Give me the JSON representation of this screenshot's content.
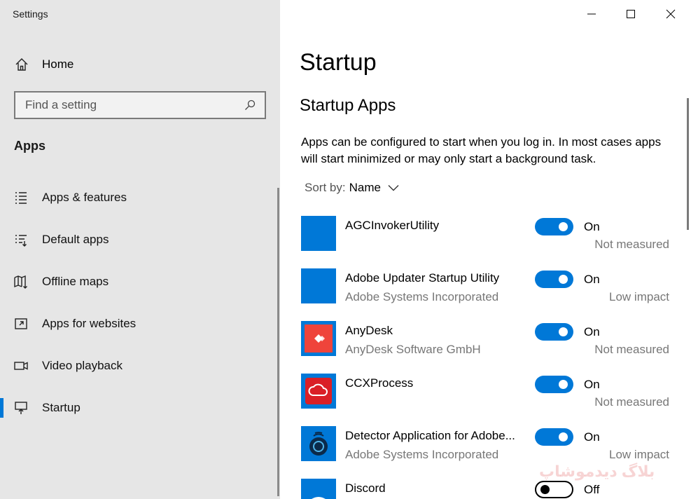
{
  "window": {
    "title": "Settings",
    "controls": [
      "minimize",
      "maximize",
      "close"
    ]
  },
  "sidebar": {
    "home_label": "Home",
    "search_placeholder": "Find a setting",
    "section_title": "Apps",
    "items": [
      {
        "label": "Apps & features",
        "icon": "apps-features-icon",
        "selected": false
      },
      {
        "label": "Default apps",
        "icon": "default-apps-icon",
        "selected": false
      },
      {
        "label": "Offline maps",
        "icon": "offline-maps-icon",
        "selected": false
      },
      {
        "label": "Apps for websites",
        "icon": "apps-websites-icon",
        "selected": false
      },
      {
        "label": "Video playback",
        "icon": "video-playback-icon",
        "selected": false
      },
      {
        "label": "Startup",
        "icon": "startup-icon",
        "selected": true
      }
    ]
  },
  "main": {
    "title": "Startup",
    "subtitle": "Startup Apps",
    "description": "Apps can be configured to start when you log in. In most cases apps will start minimized or may only start a background task.",
    "sort_label": "Sort by:",
    "sort_value": "Name",
    "apps": [
      {
        "name": "AGCInvokerUtility",
        "publisher": "",
        "state": "On",
        "impact": "Not measured",
        "icon": "blank-app-icon"
      },
      {
        "name": "Adobe Updater Startup Utility",
        "publisher": "Adobe Systems Incorporated",
        "state": "On",
        "impact": "Low impact",
        "icon": "blank-app-icon"
      },
      {
        "name": "AnyDesk",
        "publisher": "AnyDesk Software GmbH",
        "state": "On",
        "impact": "Not measured",
        "icon": "anydesk-icon"
      },
      {
        "name": "CCXProcess",
        "publisher": "",
        "state": "On",
        "impact": "Not measured",
        "icon": "creative-cloud-icon"
      },
      {
        "name": "Detector Application for Adobe...",
        "publisher": "Adobe Systems Incorporated",
        "state": "On",
        "impact": "Low impact",
        "icon": "detector-icon"
      },
      {
        "name": "Discord",
        "publisher": "",
        "state": "Off",
        "impact": "",
        "icon": "discord-icon"
      }
    ]
  },
  "watermark": "بلاگ دیدموشاپ",
  "colors": {
    "accent": "#0078d7",
    "sidebar_bg": "#e6e6e6",
    "anydesk": "#ef443b",
    "creative_cloud": "#da1f26",
    "discord": "#7289da"
  }
}
